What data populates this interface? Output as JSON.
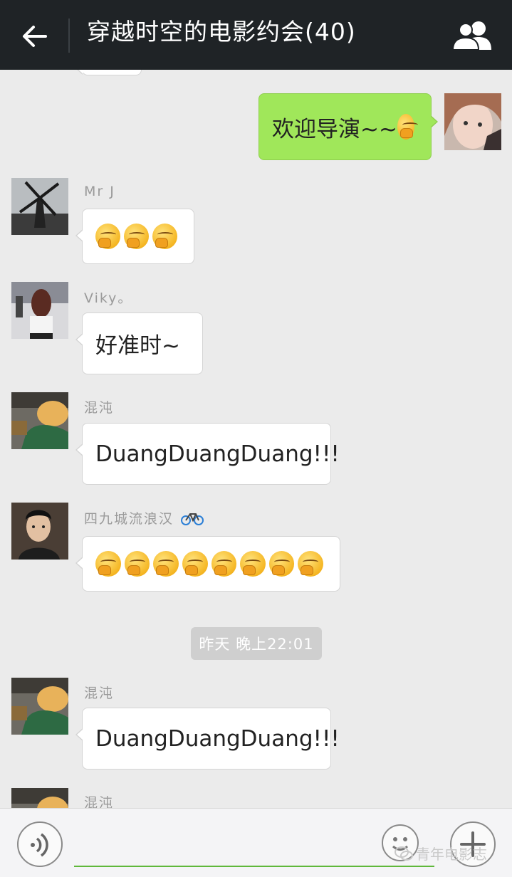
{
  "header": {
    "title": "穿越时空的电影约会(40)",
    "back_icon": "arrow-left-icon",
    "members_icon": "group-icon"
  },
  "messages": [
    {
      "side": "right",
      "text": "欢迎导演~~",
      "emoji_count": 1
    },
    {
      "side": "left",
      "sender": "Mr J",
      "text": "",
      "emoji_count": 3
    },
    {
      "side": "left",
      "sender": "Viky。",
      "text": "好准时~",
      "emoji_count": 0
    },
    {
      "side": "left",
      "sender": "混沌",
      "text": "DuangDuangDuang!!!",
      "emoji_count": 0
    },
    {
      "side": "left",
      "sender": "四九城流浪汉",
      "sender_icon": "bicycle-icon",
      "text": "",
      "emoji_count": 8
    },
    {
      "side": "left",
      "sender": "混沌",
      "text": "DuangDuangDuang!!!",
      "emoji_count": 0
    },
    {
      "side": "left",
      "sender": "混沌",
      "text": "",
      "emoji_count": 0
    }
  ],
  "timestamp": "昨天 晚上22:01",
  "input": {
    "placeholder": "",
    "value": ""
  },
  "watermark": "青年电影志",
  "colors": {
    "header_bg": "#1f2326",
    "chat_bg": "#ebebeb",
    "own_bubble": "#a0e75a",
    "accent": "#5fb83b"
  }
}
